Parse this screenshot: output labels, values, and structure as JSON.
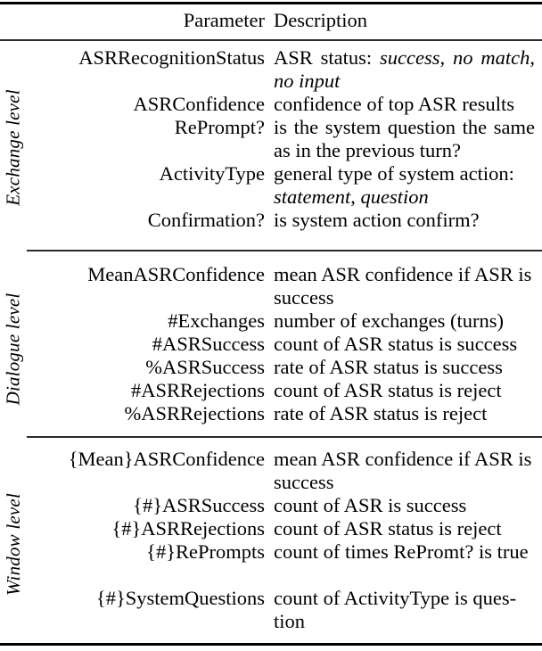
{
  "table": {
    "header": {
      "parameter": "Parameter",
      "description": "Description"
    },
    "sections": [
      {
        "label": "Exchange level",
        "rows": [
          {
            "parameter": "ASRRecognitionStatus",
            "description": "ASR status: success, no match, no input",
            "description_runs": [
              {
                "text": "ASR status: ",
                "style": "roman"
              },
              {
                "text": "success",
                "style": "italic"
              },
              {
                "text": ", ",
                "style": "roman"
              },
              {
                "text": "no match",
                "style": "italic"
              },
              {
                "text": ", ",
                "style": "roman"
              },
              {
                "text": "no input",
                "style": "italic"
              }
            ],
            "lines": 2,
            "justified": true
          },
          {
            "parameter": "ASRConfidence",
            "description": "confidence of top ASR results",
            "description_runs": [
              {
                "text": "confidence of top ASR results",
                "style": "roman"
              }
            ],
            "lines": 1,
            "justified": false
          },
          {
            "parameter": "RePrompt?",
            "description": "is the system question the same as in the previous turn?",
            "description_runs": [
              {
                "text": "is the system question the same as in the previous turn?",
                "style": "roman"
              }
            ],
            "lines": 2,
            "justified": true
          },
          {
            "parameter": "ActivityType",
            "description": "general type of system action: statement, question",
            "description_runs": [
              {
                "text": "general type of system action: ",
                "style": "roman"
              },
              {
                "text": "statement",
                "style": "italic"
              },
              {
                "text": ", ",
                "style": "roman"
              },
              {
                "text": "question",
                "style": "italic"
              }
            ],
            "lines": 2,
            "justified": false
          },
          {
            "parameter": "Confirmation?",
            "description": "is system action confirm?",
            "description_runs": [
              {
                "text": "is system action confirm?",
                "style": "roman"
              }
            ],
            "lines": 1,
            "justified": false
          }
        ]
      },
      {
        "label": "Dialogue level",
        "rows": [
          {
            "parameter": "MeanASRConfidence",
            "description": "mean ASR confidence if ASR is success",
            "description_runs": [
              {
                "text": "mean ASR confidence if ASR is success",
                "style": "roman"
              }
            ],
            "lines": 2,
            "justified": false
          },
          {
            "parameter": "#Exchanges",
            "description": "number of exchanges (turns)",
            "description_runs": [
              {
                "text": "number of exchanges (turns)",
                "style": "roman"
              }
            ],
            "lines": 1,
            "justified": false
          },
          {
            "parameter": "#ASRSuccess",
            "description": "count of ASR status is success",
            "description_runs": [
              {
                "text": "count of ASR status is success",
                "style": "roman"
              }
            ],
            "lines": 1,
            "justified": false
          },
          {
            "parameter": "%ASRSuccess",
            "description": "rate of ASR status is success",
            "description_runs": [
              {
                "text": "rate of ASR status is success",
                "style": "roman"
              }
            ],
            "lines": 1,
            "justified": false
          },
          {
            "parameter": "#ASRRejections",
            "description": "count of ASR status is reject",
            "description_runs": [
              {
                "text": "count of ASR status is reject",
                "style": "roman"
              }
            ],
            "lines": 1,
            "justified": false
          },
          {
            "parameter": "%ASRRejections",
            "description": "rate of ASR status is reject",
            "description_runs": [
              {
                "text": "rate of ASR status is reject",
                "style": "roman"
              }
            ],
            "lines": 1,
            "justified": false
          }
        ]
      },
      {
        "label": "Window level",
        "rows": [
          {
            "parameter": "{Mean}ASRConfidence",
            "description": "mean ASR confidence if ASR is success",
            "description_runs": [
              {
                "text": "mean ASR confidence if ASR is success",
                "style": "roman"
              }
            ],
            "lines": 2,
            "justified": false
          },
          {
            "parameter": "{#}ASRSuccess",
            "description": "count of ASR is success",
            "description_runs": [
              {
                "text": "count of ASR is success",
                "style": "roman"
              }
            ],
            "lines": 1,
            "justified": false
          },
          {
            "parameter": "{#}ASRRejections",
            "description": "count of ASR status is reject",
            "description_runs": [
              {
                "text": "count of ASR status is reject",
                "style": "roman"
              }
            ],
            "lines": 1,
            "justified": false
          },
          {
            "parameter": "{#}RePrompts",
            "description": "count of times RePromt? is true",
            "description_runs": [
              {
                "text": "count of times RePromt? is true",
                "style": "roman"
              }
            ],
            "lines": 2,
            "justified": true
          },
          {
            "parameter": "{#}SystemQuestions",
            "description": "count of ActivityType is question",
            "description_runs": [
              {
                "text": "count of ActivityType is ques-tion",
                "style": "roman"
              }
            ],
            "lines": 2,
            "justified": false
          }
        ]
      }
    ],
    "rules": {
      "top": "thick",
      "header": "thin",
      "section_separators": "thin-partial",
      "bottom": "thick"
    },
    "colors": {
      "text": "#000000",
      "rule": "#000000"
    }
  }
}
